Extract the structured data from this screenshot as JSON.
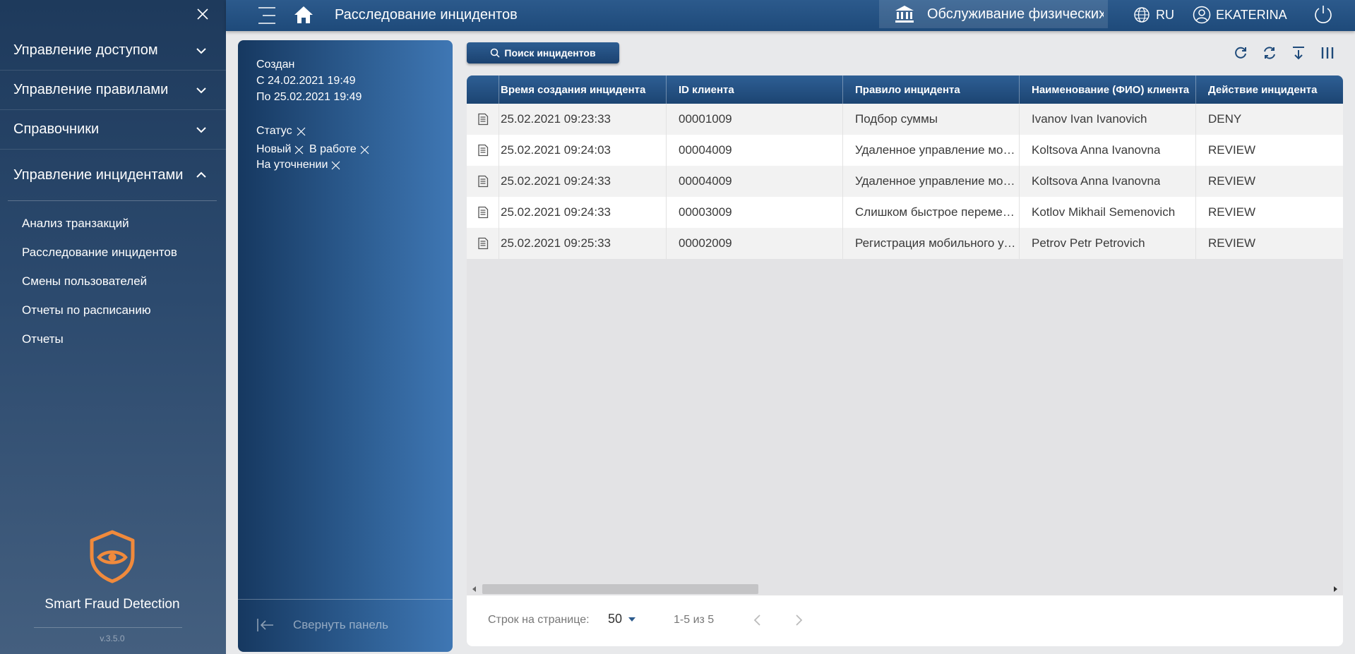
{
  "sidebar": {
    "groups": [
      {
        "label": "Управление доступом"
      },
      {
        "label": "Управление правилами"
      },
      {
        "label": "Справочники"
      },
      {
        "label": "Управление инцидентами"
      }
    ],
    "subitems": [
      {
        "label": "Анализ транзакций"
      },
      {
        "label": "Расследование инцидентов"
      },
      {
        "label": "Смены пользователей"
      },
      {
        "label": "Отчеты по расписанию"
      },
      {
        "label": "Отчеты"
      }
    ],
    "brand": "Smart Fraud Detection",
    "version": "v.3.5.0",
    "accent_color": "#f08a3c"
  },
  "header": {
    "title": "Расследование инцидентов",
    "org": "Обслуживание физических лиц",
    "lang": "RU",
    "user": "EKATERINA"
  },
  "filter": {
    "created_label": "Создан",
    "from": "С 24.02.2021 19:49",
    "to": "По 25.02.2021 19:49",
    "status_label": "Статус",
    "chips": [
      "Новый",
      "В работе",
      "На уточнении"
    ],
    "collapse_label": "Свернуть панель"
  },
  "toolbar": {
    "search_label": "Поиск инцидентов"
  },
  "table": {
    "columns": [
      "Время создания инцидента",
      "ID клиента",
      "Правило инцидента",
      "Наименование (ФИО) клиента",
      "Действие инцидента"
    ],
    "rows": [
      [
        "25.02.2021 09:23:33",
        "00001009",
        "Подбор суммы",
        "Ivanov Ivan Ivanovich",
        "DENY"
      ],
      [
        "25.02.2021 09:24:03",
        "00004009",
        "Удаленное управление мобильным устройством",
        "Koltsova Anna Ivanovna",
        "REVIEW"
      ],
      [
        "25.02.2021 09:24:33",
        "00004009",
        "Удаленное управление мобильным устройством",
        "Koltsova Anna Ivanovna",
        "REVIEW"
      ],
      [
        "25.02.2021 09:24:33",
        "00003009",
        "Слишком быстрое перемещение",
        "Kotlov Mikhail Semenovich",
        "REVIEW"
      ],
      [
        "25.02.2021 09:25:33",
        "00002009",
        "Регистрация мобильного устройства",
        "Petrov Petr Petrovich",
        "REVIEW"
      ]
    ]
  },
  "pager": {
    "rows_label": "Строк на странице:",
    "page_size": "50",
    "range": "1-5 из 5"
  }
}
